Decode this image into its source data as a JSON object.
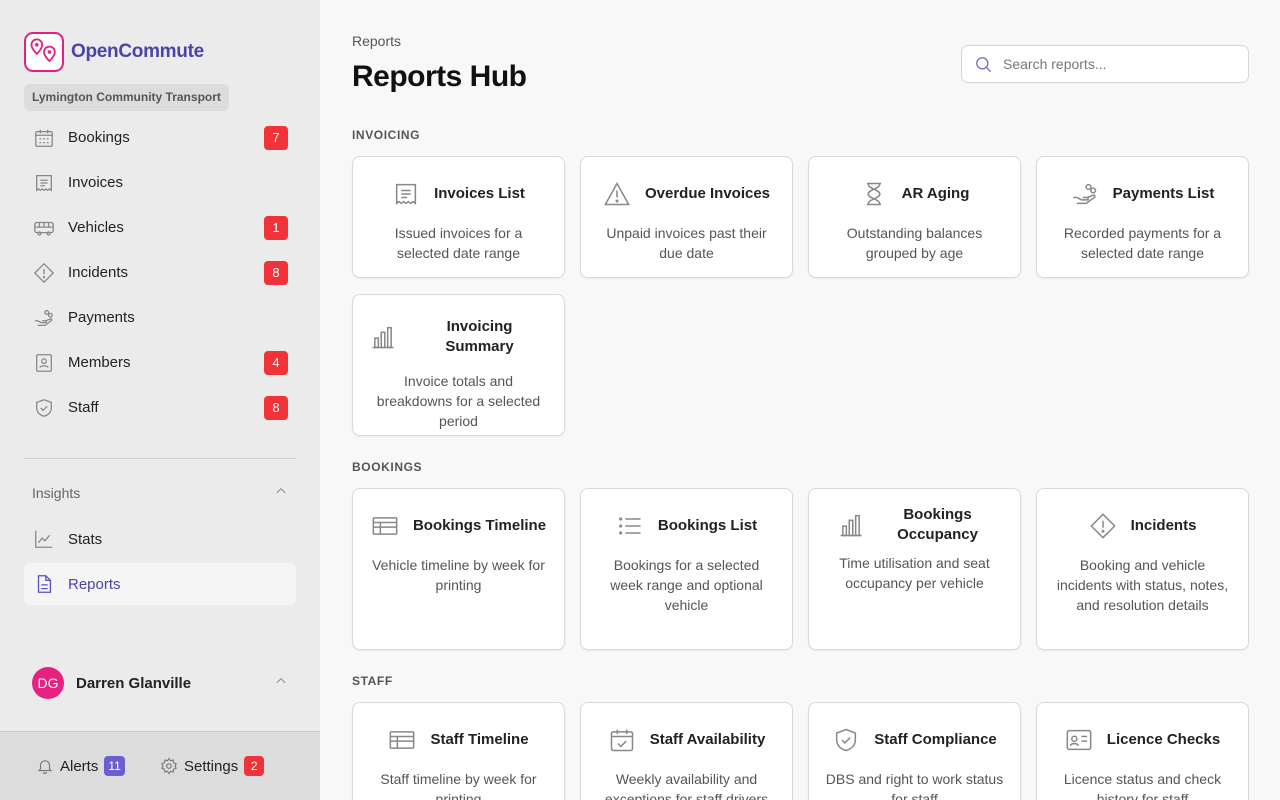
{
  "brand": {
    "name": "OpenCommute",
    "org": "Lymington Community Transport"
  },
  "colors": {
    "accent": "#4b44a8",
    "brand_pink": "#e2217e",
    "badge_red": "#f03239",
    "badge_purple": "#6b5fd0"
  },
  "sidebar": {
    "items": [
      {
        "label": "Bookings",
        "icon": "calendar-icon",
        "badge": "7"
      },
      {
        "label": "Invoices",
        "icon": "invoice-icon",
        "badge": null
      },
      {
        "label": "Vehicles",
        "icon": "bus-icon",
        "badge": "1"
      },
      {
        "label": "Incidents",
        "icon": "warning-diamond-icon",
        "badge": "8"
      },
      {
        "label": "Payments",
        "icon": "hand-coins-icon",
        "badge": null
      },
      {
        "label": "Members",
        "icon": "id-badge-icon",
        "badge": "4"
      },
      {
        "label": "Staff",
        "icon": "shield-check-icon",
        "badge": "8"
      }
    ],
    "insights_label": "Insights",
    "insights_items": [
      {
        "label": "Stats",
        "icon": "line-chart-icon"
      },
      {
        "label": "Reports",
        "icon": "document-icon"
      }
    ],
    "user": {
      "initials": "DG",
      "name": "Darren Glanville"
    },
    "bottom": {
      "alerts_label": "Alerts",
      "alerts_count": "11",
      "settings_label": "Settings",
      "settings_count": "2"
    }
  },
  "main": {
    "breadcrumb": "Reports",
    "title": "Reports Hub",
    "search_placeholder": "Search reports...",
    "groups": [
      {
        "label": "INVOICING",
        "cards": [
          {
            "title": "Invoices List",
            "desc": "Issued invoices for a selected date range",
            "icon": "invoice-icon"
          },
          {
            "title": "Overdue Invoices",
            "desc": "Unpaid invoices past their due date",
            "icon": "warning-triangle-icon"
          },
          {
            "title": "AR Aging",
            "desc": "Outstanding balances grouped by age",
            "icon": "hourglass-icon"
          },
          {
            "title": "Payments List",
            "desc": "Recorded payments for a selected date range",
            "icon": "hand-coins-icon"
          },
          {
            "title": "Invoicing Summary",
            "desc": "Invoice totals and breakdowns for a selected period",
            "icon": "bar-chart-icon"
          }
        ]
      },
      {
        "label": "BOOKINGS",
        "cards": [
          {
            "title": "Bookings Timeline",
            "desc": "Vehicle timeline by week for printing",
            "icon": "timeline-table-icon"
          },
          {
            "title": "Bookings List",
            "desc": "Bookings for a selected week range and optional vehicle",
            "icon": "list-icon"
          },
          {
            "title": "Bookings Occupancy",
            "desc": "Time utilisation and seat occupancy per vehicle",
            "icon": "bar-chart-icon"
          },
          {
            "title": "Incidents",
            "desc": "Booking and vehicle incidents with status, notes, and resolution details",
            "icon": "warning-diamond-icon"
          }
        ]
      },
      {
        "label": "STAFF",
        "cards": [
          {
            "title": "Staff Timeline",
            "desc": "Staff timeline by week for printing",
            "icon": "timeline-table-icon"
          },
          {
            "title": "Staff Availability",
            "desc": "Weekly availability and exceptions for staff drivers",
            "icon": "calendar-check-icon"
          },
          {
            "title": "Staff Compliance",
            "desc": "DBS and right to work status for staff",
            "icon": "shield-check-icon"
          },
          {
            "title": "Licence Checks",
            "desc": "Licence status and check history for staff",
            "icon": "id-card-icon"
          }
        ]
      }
    ]
  }
}
